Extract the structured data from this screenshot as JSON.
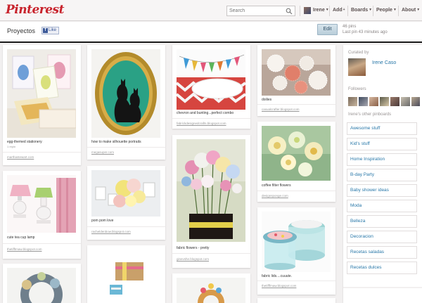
{
  "header": {
    "logo": "Pinterest",
    "search_placeholder": "Search",
    "user_name": "Irene",
    "nav_add": "Add",
    "nav_boards": "Boards",
    "nav_people": "People",
    "nav_about": "About"
  },
  "board": {
    "title": "Proyectos",
    "like_label": "Like",
    "edit_label": "Edit",
    "pin_count": "46 pins",
    "last_pin": "Last pin 43 minutes ago"
  },
  "pins": [
    {
      "caption": "egg-themed stationery",
      "repins": "1 repin",
      "source": "marthastewart.com"
    },
    {
      "caption": "how to make silhouette portraits",
      "source": "megasuper.com"
    },
    {
      "caption": "chevron and bunting...perfect combo",
      "source": "fabrickdesignedcrafts.blogspot.com"
    },
    {
      "caption": "doilies",
      "source": "casualcrafter.blogspot.com"
    },
    {
      "caption": "cute tea cup lamp",
      "source": "thetifftmaw.blogspot.com"
    },
    {
      "caption": "pom pom love",
      "source": "racheldenbow.blogspot.com"
    },
    {
      "caption": "fabric flowers - pretty",
      "source": "ginevshe.blogspot.com"
    },
    {
      "caption": "coffee filter flowers",
      "source": "designsponge.com"
    },
    {
      "caption": "fabric lids....cuuute.",
      "source": "thetifffmaw.blogspot.com"
    }
  ],
  "sidebar": {
    "curated_by": "Curated by",
    "curator_name": "Irene Caso",
    "followers_label": "Followers",
    "other_boards_label": "Irene's other pinboards",
    "boards": [
      "Awesome stuff",
      "Kid's stuff",
      "Home Inspiration",
      "B-day Party",
      "Baby shower ideas",
      "Moda",
      "Belleza",
      "Decoracion",
      "Recetas saladas",
      "Recetas dulces"
    ]
  },
  "colors": {
    "brand_red": "#c8232c",
    "link_blue": "#2877a8",
    "facebook_blue": "#3b5998"
  }
}
